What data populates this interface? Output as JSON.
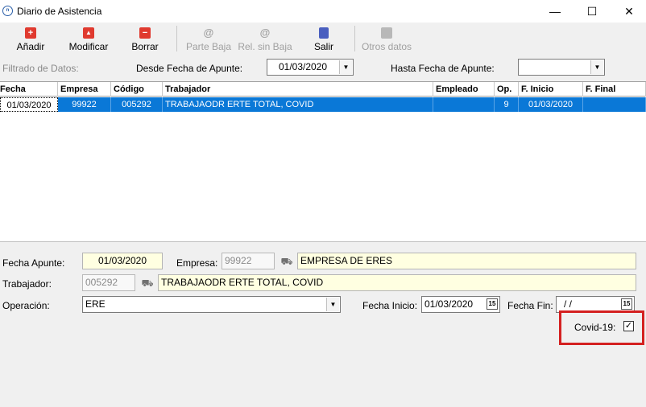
{
  "window": {
    "title": "Diario de Asistencia",
    "minimize": "—",
    "maximize": "☐",
    "close": "✕",
    "app_icon_text": "n"
  },
  "toolbar": {
    "add": "Añadir",
    "modify": "Modificar",
    "delete": "Borrar",
    "parte_baja": "Parte Baja",
    "rel_sin_baja": "Rel. sin Baja",
    "exit": "Salir",
    "other_data": "Otros datos",
    "add_icon": "+",
    "modify_icon": "▲",
    "delete_icon": "−"
  },
  "filter": {
    "label": "Filtrado de Datos:",
    "from_label": "Desde Fecha de Apunte:",
    "from_value": "01/03/2020",
    "to_label": "Hasta Fecha de Apunte:",
    "to_value": ""
  },
  "grid": {
    "columns": [
      "Fecha",
      "Empresa",
      "Código",
      "Trabajador",
      "Empleado",
      "Op.",
      "F. Inicio",
      "F. Final"
    ],
    "rows": [
      {
        "fecha": "01/03/2020",
        "empresa": "99922",
        "codigo": "005292",
        "trabajador": "TRABAJAODR ERTE TOTAL, COVID",
        "empleado": "",
        "op": "9",
        "f_inicio": "01/03/2020",
        "f_final": ""
      }
    ]
  },
  "form": {
    "fecha_apunte_label": "Fecha Apunte:",
    "fecha_apunte_value": "01/03/2020",
    "empresa_label": "Empresa:",
    "empresa_code": "99922",
    "empresa_name": "EMPRESA DE ERES",
    "trabajador_label": "Trabajador:",
    "trabajador_code": "005292",
    "trabajador_name": "TRABAJAODR ERTE TOTAL, COVID",
    "operacion_label": "Operación:",
    "operacion_value": "ERE",
    "fecha_inicio_label": "Fecha Inicio:",
    "fecha_inicio_value": "01/03/2020",
    "fecha_fin_label": "Fecha Fin:",
    "fecha_fin_value": "/ /",
    "covid_label": "Covid-19:",
    "covid_checked": "✓",
    "calendar_icon_text": "15"
  },
  "colors": {
    "selection": "#0a78d7",
    "highlight_box": "#d42020",
    "field_yellow": "#ffffe1"
  }
}
